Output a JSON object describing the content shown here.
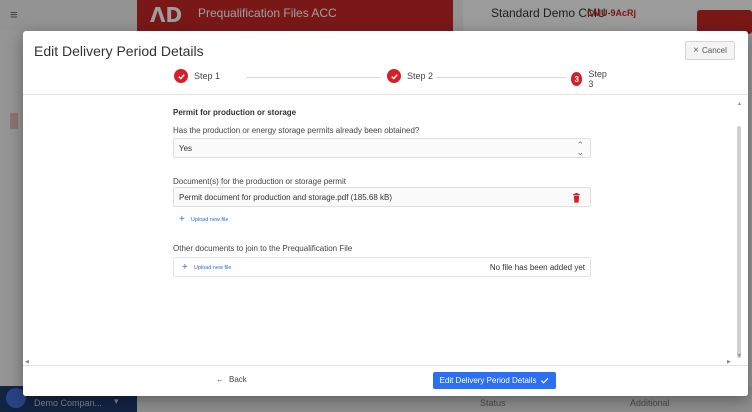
{
  "background": {
    "menu_icon": "≡",
    "logo_text": "ΛD",
    "app_title": "Prequalification Files ACC",
    "right_title": "Standard Demo CMU",
    "cmu_code": "CMU-9AcRj",
    "company": "Demo Compan...",
    "status_label": "Status",
    "additional_label": "Additional"
  },
  "modal": {
    "title": "Edit Delivery Period Details",
    "cancel_label": "Cancel",
    "steps": [
      {
        "label": "Step 1",
        "state": "done"
      },
      {
        "label": "Step 2",
        "state": "done"
      },
      {
        "label": "Step 3",
        "state": "current",
        "number": "3"
      }
    ]
  },
  "form": {
    "section_title": "Permit for production or storage",
    "question": "Has the production or energy storage permits already been obtained?",
    "select_value": "Yes",
    "documents_label": "Document(s) for the production or storage permit",
    "file_name": "Permit document for production and storage.pdf (185.68 kB)",
    "upload_label": "Upload new file",
    "other_label": "Other documents to join to the Prequalification File",
    "other_upload_label": "Upload new file",
    "no_file_text": "No file has been added yet"
  },
  "footer": {
    "back_label": "Back",
    "primary_label": "Edit Delivery Period Details"
  },
  "colors": {
    "brand_red": "#d3202b",
    "primary_blue": "#2d6ff2",
    "link_blue": "#2b6fd6"
  }
}
